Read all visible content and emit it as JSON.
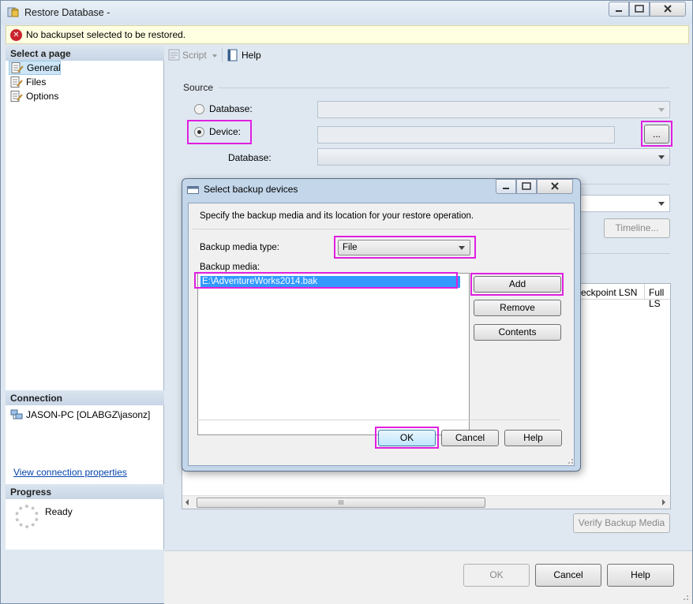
{
  "window": {
    "title": "Restore Database -",
    "caption_buttons": [
      "minimize",
      "maximize",
      "close"
    ]
  },
  "error_bar": {
    "icon": "error-x-icon",
    "text": "No backupset selected to be restored."
  },
  "left_pane": {
    "select_page_header": "Select a page",
    "pages": [
      {
        "label": "General",
        "selected": true
      },
      {
        "label": "Files",
        "selected": false
      },
      {
        "label": "Options",
        "selected": false
      }
    ],
    "connection_header": "Connection",
    "connection_text": "JASON-PC [OLABGZ\\jasonz]",
    "connection_link": "View connection properties",
    "progress_header": "Progress",
    "progress_status": "Ready"
  },
  "toolbar": {
    "script_label": "Script",
    "help_label": "Help"
  },
  "source": {
    "label": "Source",
    "database_option": "Database:",
    "device_option": "Device:",
    "selected": "Device",
    "device_value": "",
    "browse_label": "...",
    "database_label": "Database:"
  },
  "main": {
    "timeline_label": "Timeline...",
    "col_checkpoint": "eckpoint LSN",
    "col_full": "Full LS",
    "scroll_grip": "III",
    "verify_label": "Verify Backup Media"
  },
  "footer": {
    "ok": "OK",
    "cancel": "Cancel",
    "help": "Help"
  },
  "dialog": {
    "title": "Select backup devices",
    "instructions": "Specify the backup media and its location for your restore operation.",
    "media_type_label": "Backup media type:",
    "media_type_value": "File",
    "media_label": "Backup media:",
    "media_items": [
      "E:\\AdventureWorks2014.bak"
    ],
    "add_label": "Add",
    "remove_label": "Remove",
    "contents_label": "Contents",
    "ok_label": "OK",
    "cancel_label": "Cancel",
    "help_label": "Help"
  },
  "colors": {
    "highlight": "#e01fe0",
    "selection": "#3399ff",
    "error": "#c8232c"
  }
}
